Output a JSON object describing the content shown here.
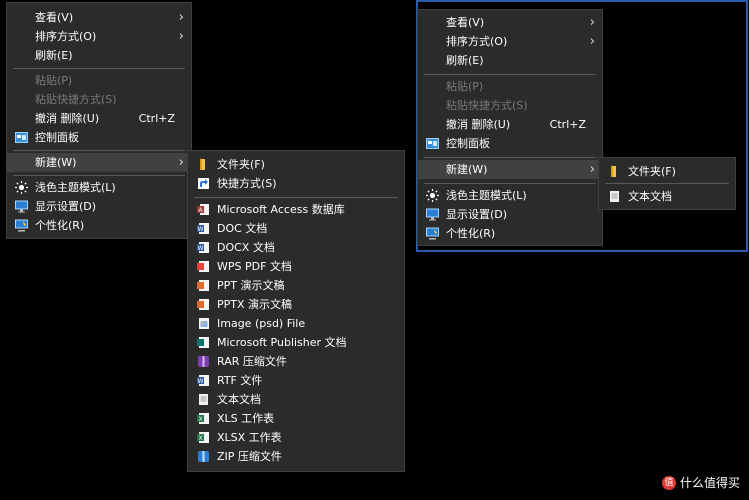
{
  "left_context_menu": {
    "items": [
      {
        "label": "查看(V)",
        "has_submenu": true
      },
      {
        "label": "排序方式(O)",
        "has_submenu": true
      },
      {
        "label": "刷新(E)"
      },
      {
        "label": "粘贴(P)",
        "disabled": true
      },
      {
        "label": "粘贴快捷方式(S)",
        "disabled": true
      },
      {
        "label": "撤消 删除(U)",
        "shortcut": "Ctrl+Z"
      },
      {
        "label": "控制面板",
        "icon": "control-panel-icon"
      },
      {
        "label": "新建(W)",
        "has_submenu": true,
        "highlighted": true
      },
      {
        "label": "浅色主题模式(L)",
        "icon": "sun-icon"
      },
      {
        "label": "显示设置(D)",
        "icon": "display-settings-icon"
      },
      {
        "label": "个性化(R)",
        "icon": "personalize-icon"
      }
    ]
  },
  "left_new_submenu": {
    "items": [
      {
        "label": "文件夹(F)",
        "icon": "folder-icon"
      },
      {
        "label": "快捷方式(S)",
        "icon": "shortcut-icon"
      },
      {
        "label": "Microsoft Access 数据库",
        "icon": "access-icon"
      },
      {
        "label": "DOC 文档",
        "icon": "doc-icon"
      },
      {
        "label": "DOCX 文档",
        "icon": "docx-icon"
      },
      {
        "label": "WPS PDF 文档",
        "icon": "pdf-icon"
      },
      {
        "label": "PPT 演示文稿",
        "icon": "ppt-icon"
      },
      {
        "label": "PPTX 演示文稿",
        "icon": "pptx-icon"
      },
      {
        "label": "Image (psd) File",
        "icon": "psd-icon"
      },
      {
        "label": "Microsoft Publisher 文档",
        "icon": "publisher-icon"
      },
      {
        "label": "RAR 压缩文件",
        "icon": "rar-icon"
      },
      {
        "label": "RTF 文件",
        "icon": "rtf-icon"
      },
      {
        "label": "文本文档",
        "icon": "text-doc-icon"
      },
      {
        "label": "XLS 工作表",
        "icon": "xls-icon"
      },
      {
        "label": "XLSX 工作表",
        "icon": "xlsx-icon"
      },
      {
        "label": "ZIP 压缩文件",
        "icon": "zip-icon"
      }
    ]
  },
  "right_context_menu": {
    "items": [
      {
        "label": "查看(V)",
        "has_submenu": true
      },
      {
        "label": "排序方式(O)",
        "has_submenu": true
      },
      {
        "label": "刷新(E)"
      },
      {
        "label": "粘贴(P)",
        "disabled": true
      },
      {
        "label": "粘贴快捷方式(S)",
        "disabled": true
      },
      {
        "label": "撤消 删除(U)",
        "shortcut": "Ctrl+Z"
      },
      {
        "label": "控制面板",
        "icon": "control-panel-icon"
      },
      {
        "label": "新建(W)",
        "has_submenu": true,
        "highlighted": true
      },
      {
        "label": "浅色主题模式(L)",
        "icon": "sun-icon"
      },
      {
        "label": "显示设置(D)",
        "icon": "display-settings-icon"
      },
      {
        "label": "个性化(R)",
        "icon": "personalize-icon"
      }
    ]
  },
  "right_new_submenu": {
    "items": [
      {
        "label": "文件夹(F)",
        "icon": "folder-icon"
      },
      {
        "label": "文本文档",
        "icon": "text-doc-icon"
      }
    ]
  },
  "watermark": {
    "text": "什么值得买",
    "logo": "值"
  },
  "colors": {
    "menu_bg": "#2b2b2b",
    "highlight": "#414141",
    "disabled_text": "#7a7a7a",
    "frame_border": "#2b5ca8"
  }
}
